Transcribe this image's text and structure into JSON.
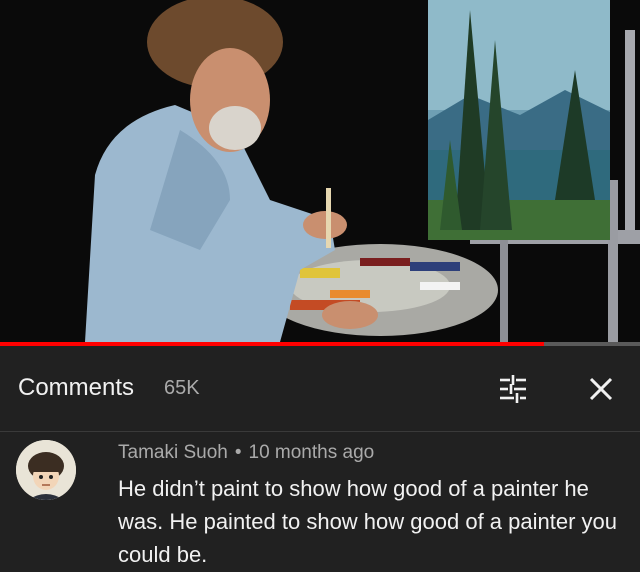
{
  "video": {
    "progress_fraction": 0.85
  },
  "comments_panel": {
    "title": "Comments",
    "count": "65K",
    "filter_icon": "sort-filter-icon",
    "close_icon": "close-icon"
  },
  "comment": {
    "author": "Tamaki Suoh",
    "separator": "•",
    "time": "10 months ago",
    "text": "He didn’t paint to show how good of a painter he was. He painted to show how good of a painter you could be."
  },
  "colors": {
    "background": "#212121",
    "progress": "#ff0000",
    "text": "#f1f1f1",
    "secondary_text": "#aaaaaa"
  }
}
